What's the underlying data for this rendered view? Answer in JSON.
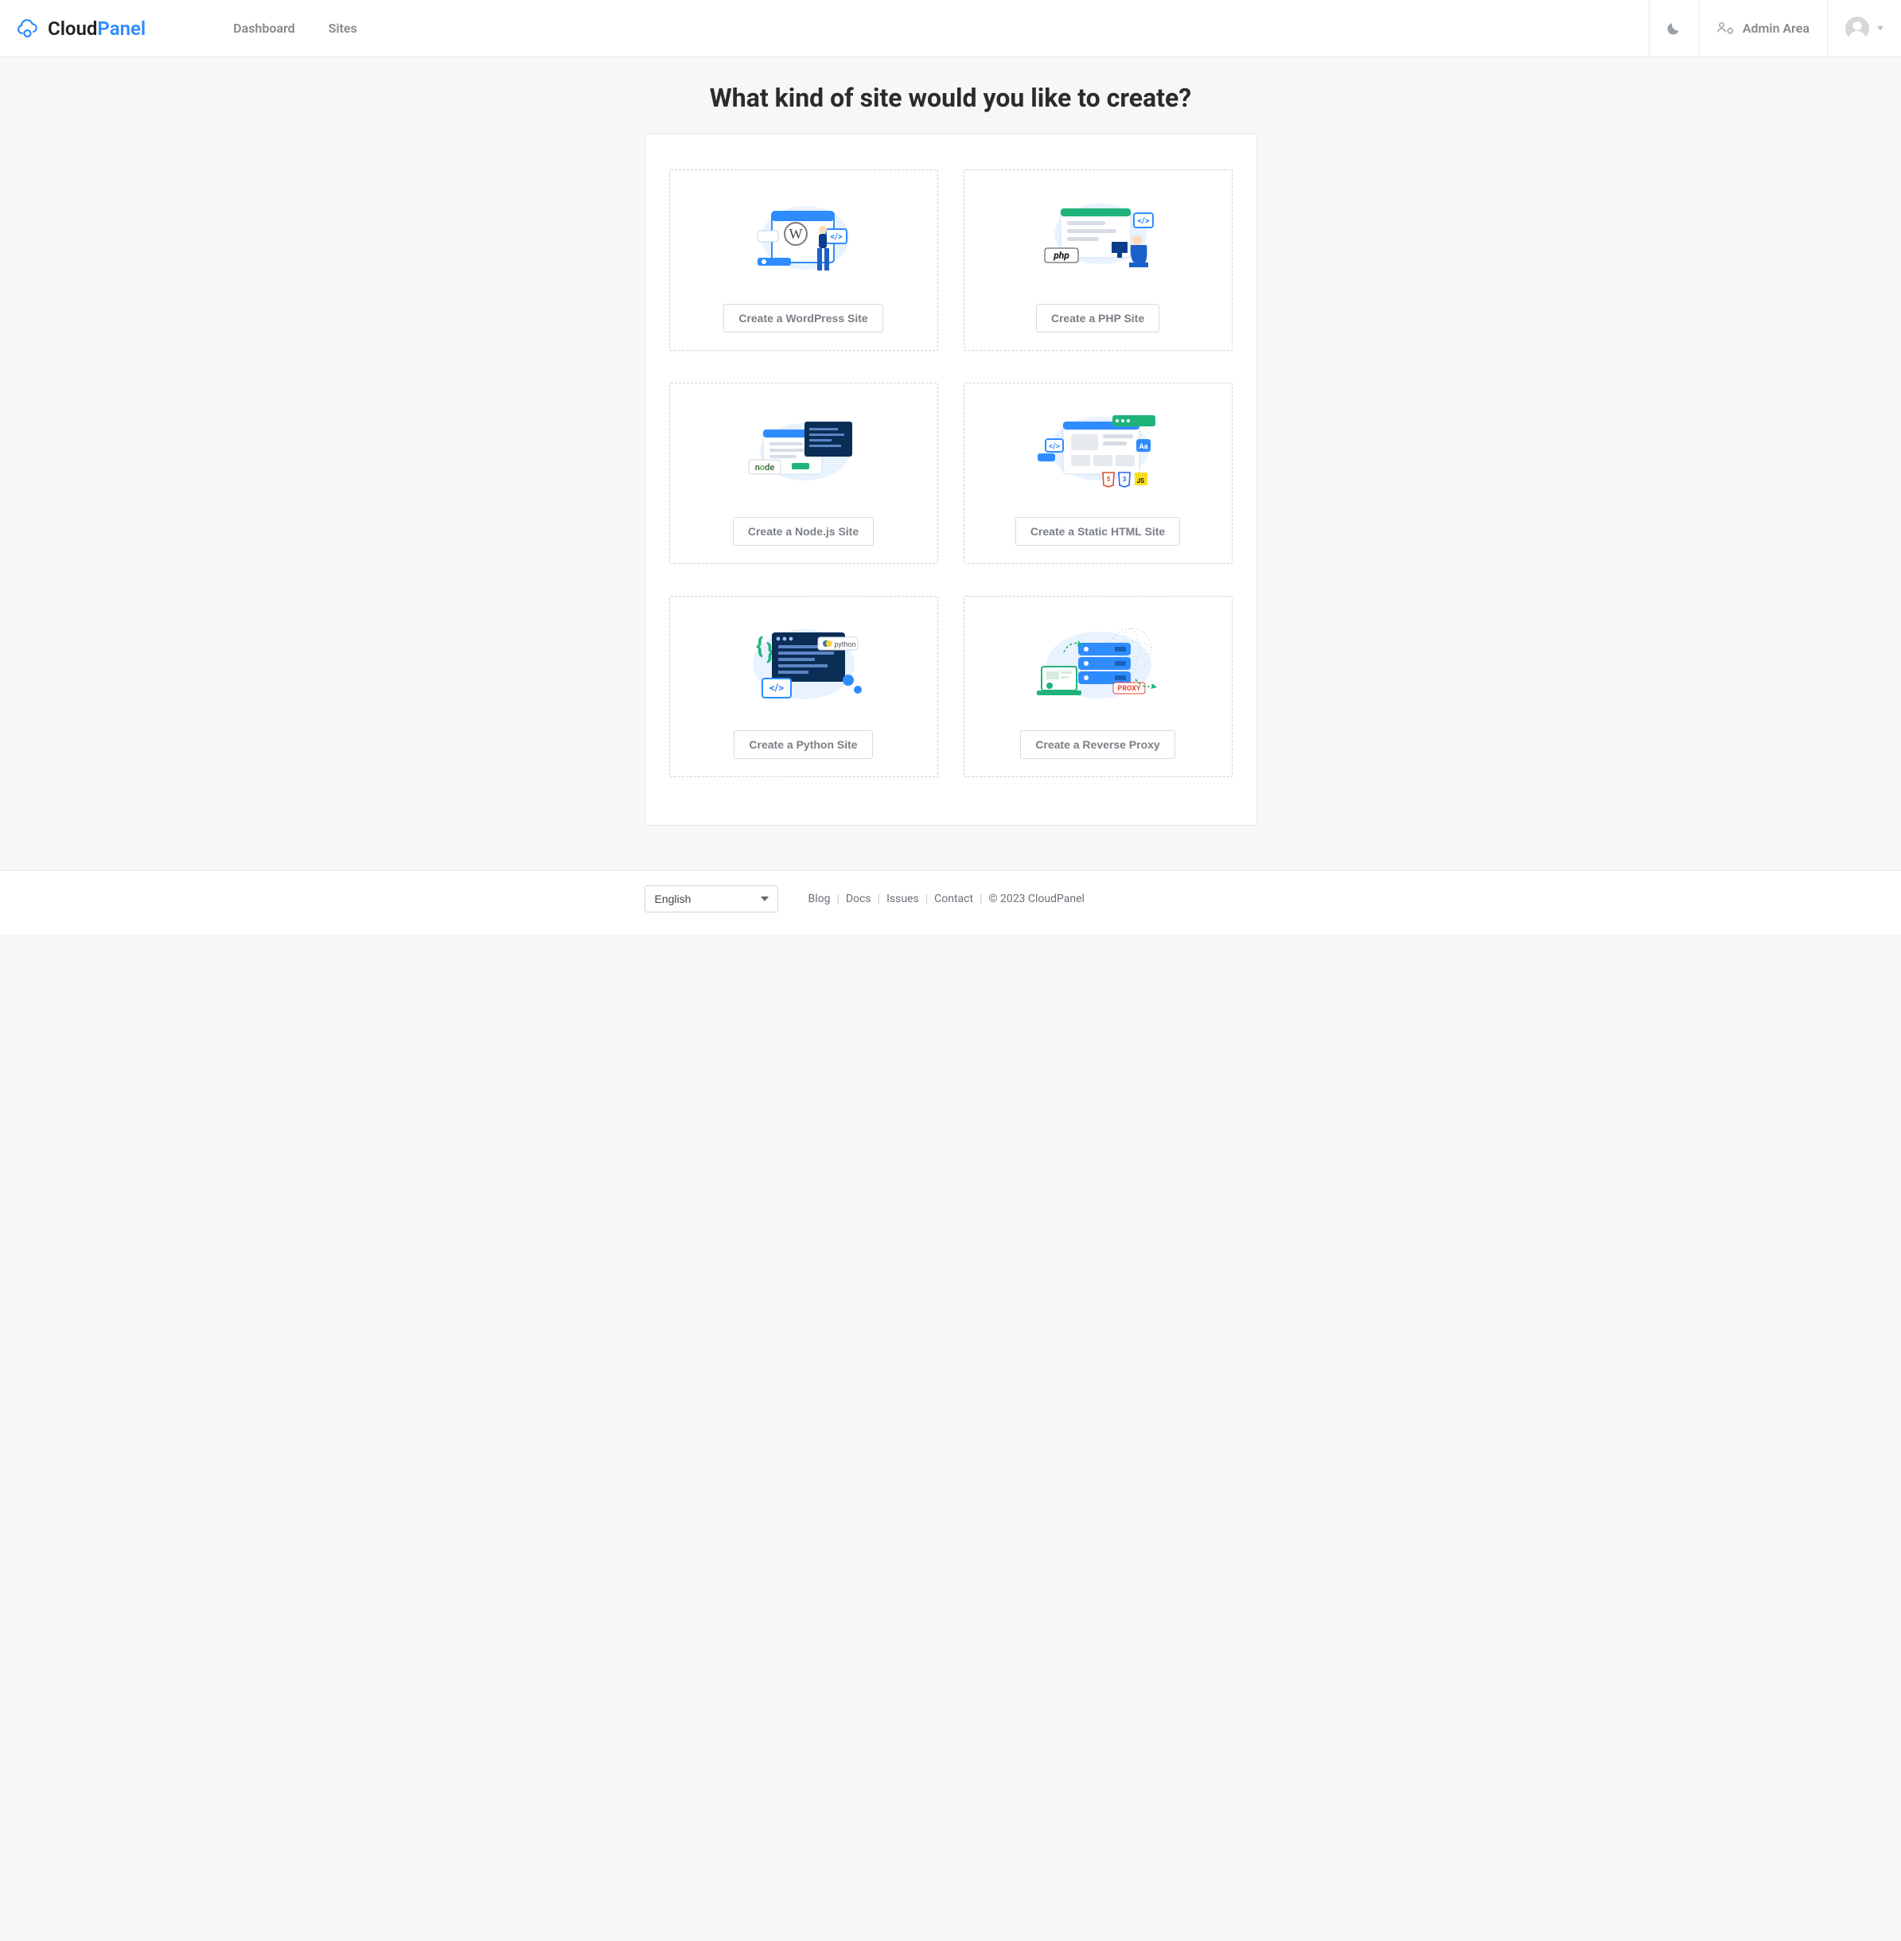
{
  "brand": {
    "part1": "Cloud",
    "part2": "Panel"
  },
  "nav": {
    "dashboard": "Dashboard",
    "sites": "Sites"
  },
  "admin": {
    "label": "Admin Area"
  },
  "page": {
    "title": "What kind of site would you like to create?"
  },
  "cards": {
    "wordpress": {
      "button": "Create a WordPress Site"
    },
    "php": {
      "button": "Create a PHP Site"
    },
    "node": {
      "button": "Create a Node.js Site"
    },
    "static": {
      "button": "Create a Static HTML Site"
    },
    "python": {
      "button": "Create a Python Site"
    },
    "proxy": {
      "button": "Create a Reverse Proxy"
    }
  },
  "footer": {
    "language": "English",
    "links": {
      "blog": "Blog",
      "docs": "Docs",
      "issues": "Issues",
      "contact": "Contact"
    },
    "copyright": "© 2023  CloudPanel"
  }
}
